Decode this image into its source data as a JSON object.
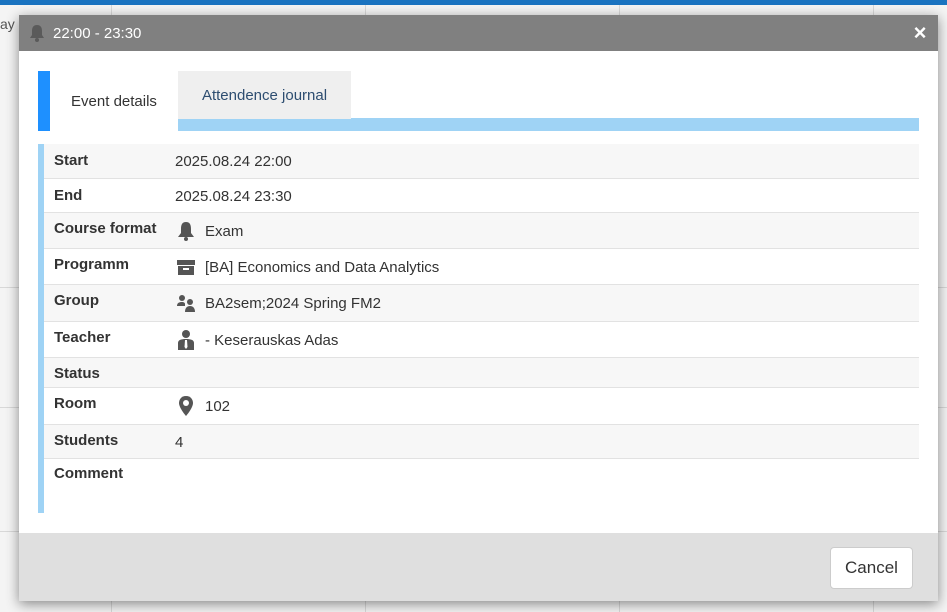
{
  "background": {
    "day_fragment": "ay"
  },
  "modal": {
    "title": "22:00 - 23:30",
    "header_icon": "bell-icon",
    "close_label": "×"
  },
  "tabs": [
    {
      "label": "Event details",
      "active": true
    },
    {
      "label": "Attendence journal",
      "active": false
    }
  ],
  "details": {
    "start": {
      "label": "Start",
      "value": "2025.08.24 22:00"
    },
    "end": {
      "label": "End",
      "value": "2025.08.24 23:30"
    },
    "course_format": {
      "label": "Course format",
      "value": "Exam",
      "icon": "bell-icon"
    },
    "programm": {
      "label": "Programm",
      "value": "[BA] Economics and Data Analytics",
      "icon": "archive-box-icon"
    },
    "group": {
      "label": "Group",
      "value": "BA2sem;2024 Spring FM2",
      "icon": "group-icon"
    },
    "teacher": {
      "label": "Teacher",
      "value": "- Keserauskas Adas",
      "icon": "person-tie-icon"
    },
    "status": {
      "label": "Status",
      "value": ""
    },
    "room": {
      "label": "Room",
      "value": "102",
      "icon": "map-pin-icon"
    },
    "students": {
      "label": "Students",
      "value": "4"
    },
    "comment": {
      "label": "Comment",
      "value": ""
    }
  },
  "footer": {
    "cancel_label": "Cancel"
  },
  "colors": {
    "header_bg": "#808080",
    "tab_accent": "#1e90ff",
    "light_blue": "#9fd3f5",
    "footer_bg": "#dfdfdf"
  }
}
